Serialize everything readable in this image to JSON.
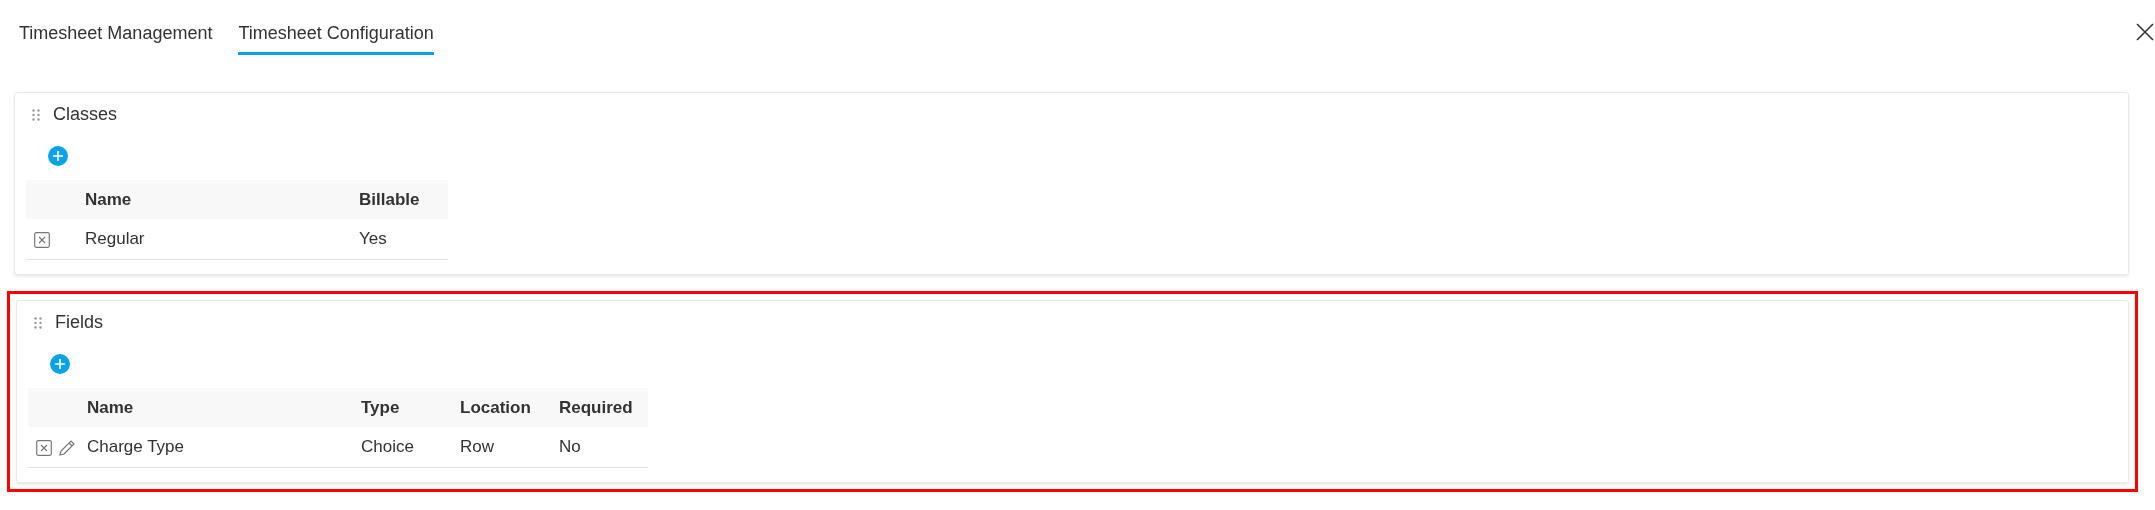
{
  "tabs": [
    {
      "label": "Timesheet Management",
      "selected": false
    },
    {
      "label": "Timesheet Configuration",
      "selected": true
    }
  ],
  "sections": [
    {
      "title": "Classes",
      "highlighted": false,
      "columns": [
        "Name",
        "Billable"
      ],
      "rows": [
        {
          "editable": false,
          "cells": [
            "Regular",
            "Yes"
          ]
        }
      ]
    },
    {
      "title": "Fields",
      "highlighted": true,
      "columns": [
        "Name",
        "Type",
        "Location",
        "Required"
      ],
      "rows": [
        {
          "editable": true,
          "cells": [
            "Charge Type",
            "Choice",
            "Row",
            "No"
          ]
        }
      ]
    }
  ]
}
